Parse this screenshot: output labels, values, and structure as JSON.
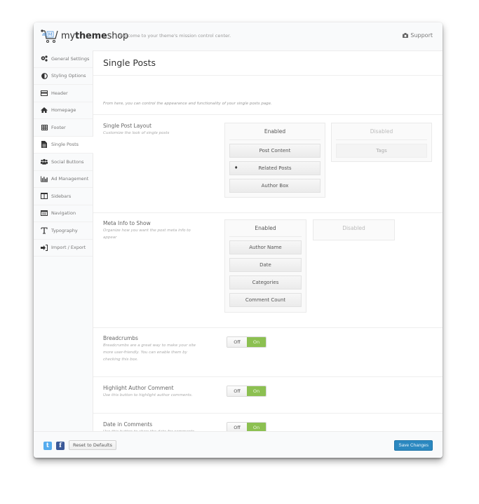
{
  "header": {
    "logo_text_a": "my",
    "logo_text_b": "theme",
    "logo_text_c": "shop",
    "welcome": "Welcome to your theme's mission control center.",
    "support_label": "Support"
  },
  "sidebar": {
    "items": [
      {
        "label": "General Settings",
        "icon": "gears-icon"
      },
      {
        "label": "Styling Options",
        "icon": "adjust-icon"
      },
      {
        "label": "Header",
        "icon": "header-icon"
      },
      {
        "label": "Homepage",
        "icon": "home-icon"
      },
      {
        "label": "Footer",
        "icon": "table-icon"
      },
      {
        "label": "Single Posts",
        "icon": "file-icon",
        "active": true
      },
      {
        "label": "Social Buttons",
        "icon": "group-icon"
      },
      {
        "label": "Ad Management",
        "icon": "bar-chart-icon"
      },
      {
        "label": "Sidebars",
        "icon": "columns-icon"
      },
      {
        "label": "Navigation",
        "icon": "navigation-icon"
      },
      {
        "label": "Typography",
        "icon": "text-height-icon"
      },
      {
        "label": "Import / Export",
        "icon": "sign-in-icon"
      }
    ]
  },
  "main": {
    "title": "Single Posts",
    "intro": "From here, you can control the appearance and functionality of your single posts page.",
    "layout": {
      "title": "Single Post Layout",
      "desc": "Customize the look of single posts",
      "enabled_label": "Enabled",
      "disabled_label": "Disabled",
      "enabled": [
        "Post Content",
        "Related Posts",
        "Author Box"
      ],
      "disabled": [
        "Tags"
      ],
      "drag_marker": "♦"
    },
    "meta": {
      "title": "Meta Info to Show",
      "desc": "Organize how you want the post meta info to appear",
      "enabled_label": "Enabled",
      "disabled_label": "Disabled",
      "enabled": [
        "Author Name",
        "Date",
        "Categories",
        "Comment Count"
      ],
      "disabled": []
    },
    "breadcrumbs": {
      "title": "Breadcrumbs",
      "desc": "Breadcrumbs are a great way to make your site more user-friendly. You can enable them by checking this box.",
      "off": "Off",
      "on": "On",
      "value": "On"
    },
    "highlight": {
      "title": "Highlight Author Comment",
      "desc": "Use this button to highlight author comments.",
      "off": "Off",
      "on": "On",
      "value": "On"
    },
    "date_comments": {
      "title": "Date in Comments",
      "desc": "Use this button to show the date for comments.",
      "off": "Off",
      "on": "On",
      "value": "On"
    }
  },
  "footer": {
    "twitter": "t",
    "facebook": "f",
    "reset_label": "Reset to Defaults",
    "save_label": "Save Changes"
  },
  "colors": {
    "accent_green": "#8cc051",
    "save_blue": "#2b88c0",
    "twitter_blue": "#55acee",
    "facebook_blue": "#3b5998",
    "logo_blue": "#4a90d9"
  }
}
